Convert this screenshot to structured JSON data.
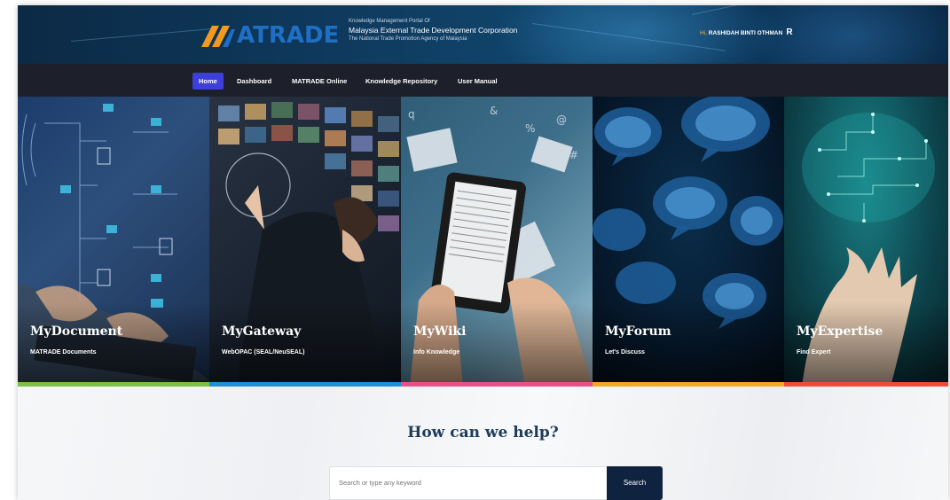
{
  "header": {
    "logo_text_prefix": "M",
    "logo_text": "ATRADE",
    "portal_line1": "Knowledge Management Portal Of",
    "portal_line2": "Malaysia External Trade Development Corporation",
    "portal_line3": "The National Trade Promotion Agency of Malaysia",
    "greeting_prefix": "Hi,",
    "user_name": "RASHIDAH BINTI OTHMAN",
    "avatar_initial": "R"
  },
  "nav": {
    "items": [
      {
        "label": "Home",
        "active": true
      },
      {
        "label": "Dashboard",
        "active": false
      },
      {
        "label": "MATRADE Online",
        "active": false
      },
      {
        "label": "Knowledge Repository",
        "active": false
      },
      {
        "label": "User Manual",
        "active": false
      }
    ]
  },
  "tiles": [
    {
      "title": "MyDocument",
      "subtitle": "MATRADE Documents",
      "accent": "#7cc242"
    },
    {
      "title": "MyGateway",
      "subtitle": "WebOPAC (SEAL/NeuSEAL)",
      "accent": "#1f8fd6"
    },
    {
      "title": "MyWiki",
      "subtitle": "Info Knowledge",
      "accent": "#e8508a"
    },
    {
      "title": "MyForum",
      "subtitle": "Let's Discuss",
      "accent": "#f5a623"
    },
    {
      "title": "MyExpertise",
      "subtitle": "Find Expert",
      "accent": "#ef4a3a"
    }
  ],
  "help": {
    "title": "How can we help?",
    "search_placeholder": "Search or type any keyword",
    "search_button": "Search"
  },
  "colors": {
    "nav_active": "#3e3fd8",
    "search_button": "#0f2341"
  }
}
